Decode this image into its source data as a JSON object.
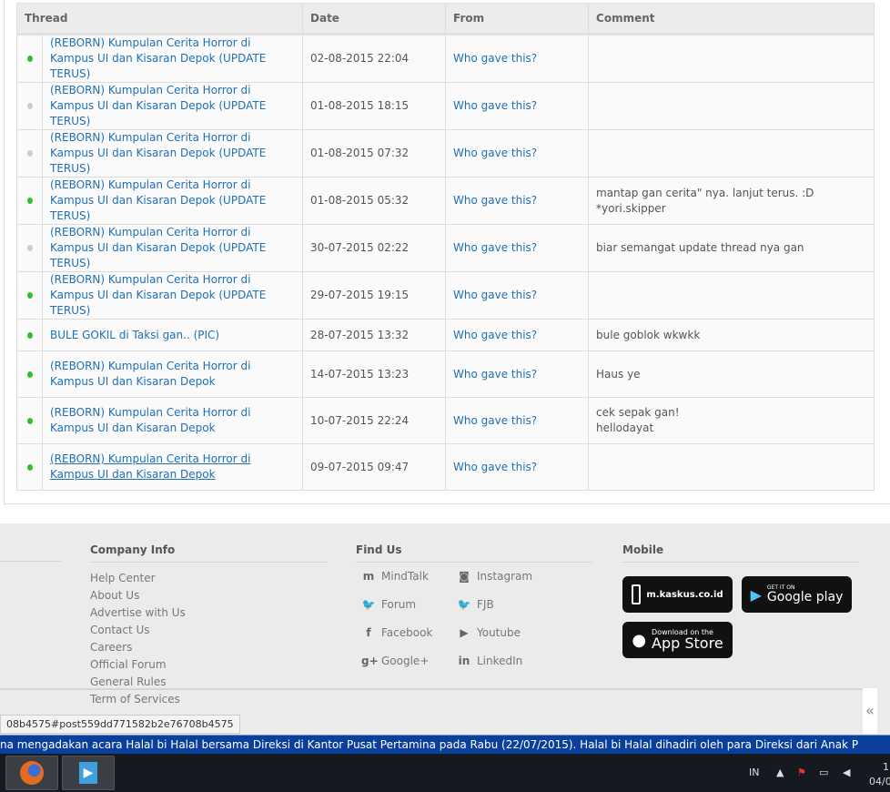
{
  "table": {
    "headers": [
      "Thread",
      "Date",
      "From",
      "Comment"
    ],
    "rows": [
      {
        "status": "green",
        "thread": "(REBORN) Kumpulan Cerita Horror di Kampus UI dan Kisaran Depok (UPDATE TERUS)",
        "date": "02-08-2015 22:04",
        "from": "Who gave this?",
        "comment": ""
      },
      {
        "status": "grey",
        "thread": "(REBORN) Kumpulan Cerita Horror di Kampus UI dan Kisaran Depok (UPDATE TERUS)",
        "date": "01-08-2015 18:15",
        "from": "Who gave this?",
        "comment": ""
      },
      {
        "status": "grey",
        "thread": "(REBORN) Kumpulan Cerita Horror di Kampus UI dan Kisaran Depok (UPDATE TERUS)",
        "date": "01-08-2015 07:32",
        "from": "Who gave this?",
        "comment": ""
      },
      {
        "status": "green",
        "thread": "(REBORN) Kumpulan Cerita Horror di Kampus UI dan Kisaran Depok (UPDATE TERUS)",
        "date": "01-08-2015 05:32",
        "from": "Who gave this?",
        "comment": "mantap gan cerita\" nya. lanjut terus. :D *yori.skipper"
      },
      {
        "status": "grey",
        "thread": "(REBORN) Kumpulan Cerita Horror di Kampus UI dan Kisaran Depok (UPDATE TERUS)",
        "date": "30-07-2015 02:22",
        "from": "Who gave this?",
        "comment": "biar semangat update thread nya gan"
      },
      {
        "status": "green",
        "thread": "(REBORN) Kumpulan Cerita Horror di Kampus UI dan Kisaran Depok (UPDATE TERUS)",
        "date": "29-07-2015 19:15",
        "from": "Who gave this?",
        "comment": ""
      },
      {
        "status": "green",
        "thread": "BULE GOKIL di Taksi gan.. (PIC)",
        "date": "28-07-2015 13:32",
        "from": "Who gave this?",
        "comment": "bule goblok wkwkk"
      },
      {
        "status": "green",
        "thread": "(REBORN) Kumpulan Cerita Horror di Kampus UI dan Kisaran Depok",
        "date": "14-07-2015 13:23",
        "from": "Who gave this?",
        "comment": "Haus ye"
      },
      {
        "status": "green",
        "thread": "(REBORN) Kumpulan Cerita Horror di Kampus UI dan Kisaran Depok",
        "date": "10-07-2015 22:24",
        "from": "Who gave this?",
        "comment": "cek sepak gan!\nhellodayat"
      },
      {
        "status": "green",
        "thread": "(REBORN) Kumpulan Cerita Horror di Kampus UI dan Kisaran Depok",
        "date": "09-07-2015 09:47",
        "from": "Who gave this?",
        "comment": ""
      }
    ]
  },
  "colors": {
    "green": "#2fbf2f",
    "grey": "#cccccc",
    "link": "#1f6fb5",
    "ticker": "#0b3f9c"
  },
  "footer": {
    "company": {
      "title": "Company Info",
      "links": [
        "Help Center",
        "About Us",
        "Advertise with Us",
        "Contact Us",
        "Careers",
        "Official Forum",
        "General Rules",
        "Term of Services"
      ]
    },
    "find": {
      "title": "Find Us",
      "items": [
        {
          "label": "MindTalk",
          "icon": "mindtalk-icon",
          "glyph": "m"
        },
        {
          "label": "Instagram",
          "icon": "instagram-icon",
          "glyph": "◙"
        },
        {
          "label": "Forum",
          "icon": "twitter-icon",
          "glyph": "🐦"
        },
        {
          "label": "FJB",
          "icon": "twitter-icon",
          "glyph": "🐦"
        },
        {
          "label": "Facebook",
          "icon": "facebook-icon",
          "glyph": "f"
        },
        {
          "label": "Youtube",
          "icon": "youtube-icon",
          "glyph": "▶"
        },
        {
          "label": "Google+",
          "icon": "googleplus-icon",
          "glyph": "g+"
        },
        {
          "label": "LinkedIn",
          "icon": "linkedin-icon",
          "glyph": "in"
        }
      ]
    },
    "mobile": {
      "title": "Mobile",
      "mkaskus": "m.kaskus.co.id",
      "gp_small": "GET IT ON",
      "gp_big": "Google play",
      "as_small": "Download on the",
      "as_big": "App Store"
    }
  },
  "status_url": "08b4575#post559dd771582b2e76708b4575",
  "ticker": "na mengadakan acara Halal bi Halal bersama Direksi di Kantor Pusat Pertamina pada Rabu (22/07/2015). Halal bi Halal dihadiri oleh para Direksi dari Anak P",
  "taskbar": {
    "lang": "IN",
    "time": "1",
    "date": "04/0"
  }
}
